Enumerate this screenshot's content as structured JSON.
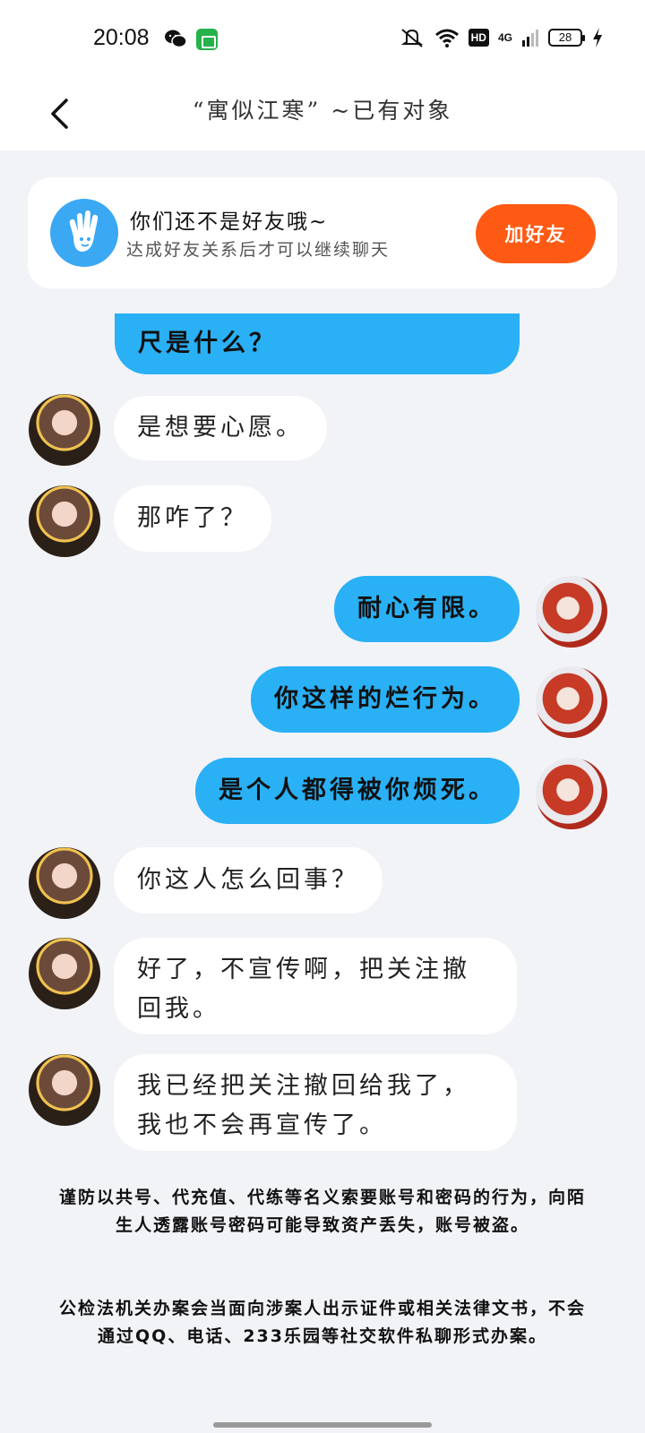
{
  "status_bar": {
    "time": "20:08",
    "hd": "HD",
    "network": "4G",
    "battery": "28"
  },
  "header": {
    "title": "“寓似江寒” ~已有对象"
  },
  "banner": {
    "title": "你们还不是好友哦~",
    "subtitle": "达成好友关系后才可以继续聊天",
    "button": "加好友"
  },
  "messages": [
    {
      "side": "out",
      "text": "尺是什么？"
    },
    {
      "side": "in",
      "text": "是想要心愿。"
    },
    {
      "side": "in",
      "text": "那咋了？"
    },
    {
      "side": "out",
      "text": "耐心有限。"
    },
    {
      "side": "out",
      "text": "你这样的烂行为。"
    },
    {
      "side": "out",
      "text": "是个人都得被你烦死。"
    },
    {
      "side": "in",
      "text": "你这人怎么回事？"
    },
    {
      "side": "in",
      "text": "好了，不宣传啊，把关注撤回我。"
    },
    {
      "side": "in",
      "text": "我已经把关注撤回给我了，我也不会再宣传了。"
    }
  ],
  "notices": [
    "谨防以共号、代充值、代练等名义索要账号和密码的行为，向陌生人透露账号密码可能导致资产丢失，账号被盗。",
    "公检法机关办案会当面向涉案人出示证件或相关法律文书，不会通过QQ、电话、233乐园等社交软件私聊形式办案。"
  ],
  "colors": {
    "outgoing_bubble": "#2ab0f5",
    "incoming_bubble": "#ffffff",
    "add_friend_button": "#ff5a14",
    "background": "#f2f3f7"
  }
}
